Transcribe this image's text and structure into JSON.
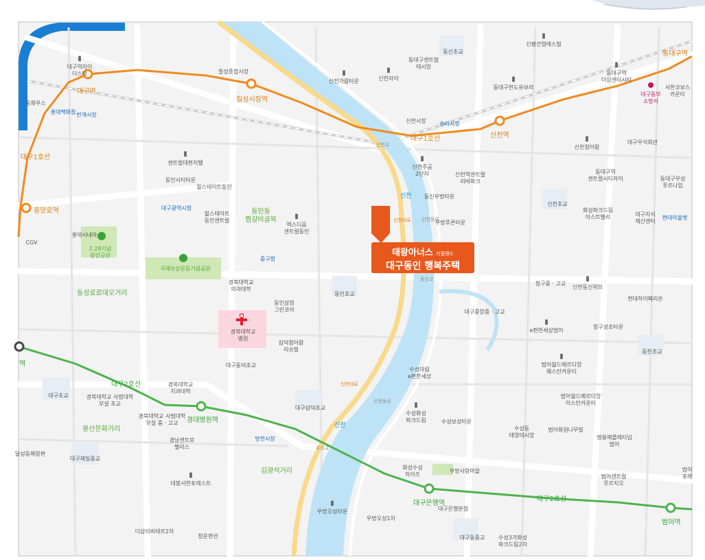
{
  "callout": {
    "brand": "태왕아너스",
    "brand_sub": "리플랜드",
    "title": "대구동인 행복주택",
    "color": "#e8581c"
  },
  "colors": {
    "line1": "#f08a1e",
    "line2": "#4cb34c",
    "river": "#bfe3f6",
    "road": "#e2e2e2",
    "park": "#cfe8b6",
    "hospital": "#fbd6e0"
  },
  "subway_stations": [
    {
      "name": "대구역"
    },
    {
      "name": "칠성시장역"
    },
    {
      "name": "신천역"
    },
    {
      "name": "동대구역"
    },
    {
      "name": "중앙로역"
    },
    {
      "name": "경대병원역"
    },
    {
      "name": "대구은행역"
    },
    {
      "name": "범어역"
    },
    {
      "name": "역"
    }
  ],
  "line_labels": {
    "line1_a": "대구1호선",
    "line1_b": "대구1호선",
    "line2_a": "대구2호선",
    "line2_b": "대구2호선"
  },
  "districts": [
    {
      "name": "동인동\n찜갈비골목"
    },
    {
      "name": "동성로로데오거리"
    },
    {
      "name": "봉산문화거리"
    },
    {
      "name": "김광석거리"
    }
  ],
  "river_labels": [
    "신천",
    "신천"
  ],
  "road_labels": [
    "신천대로",
    "신천대로",
    "신천동로",
    "신천동로",
    "신천교",
    "동신교",
    "수성교"
  ],
  "public": [
    {
      "name": "중구청"
    },
    {
      "name": "대구광역시청"
    },
    {
      "name": "롯데백화점"
    },
    {
      "name": "번개시장"
    },
    {
      "name": "송라시장"
    },
    {
      "name": "현대아울렛"
    },
    {
      "name": "방천시장"
    },
    {
      "name": "대구동부\n소방서"
    }
  ],
  "places": [
    {
      "name": "대구역자이\n더스타"
    },
    {
      "name": "칠성종합시장"
    },
    {
      "name": "신천가람타운"
    },
    {
      "name": "신천자이"
    },
    {
      "name": "동대구센트럴\n데시앙"
    },
    {
      "name": "동신초교"
    },
    {
      "name": "신평건영레스빌"
    },
    {
      "name": "동대구헌도유보라"
    },
    {
      "name": "동대구역\n더샵센터시티"
    },
    {
      "name": "서한코보스\n카운티"
    },
    {
      "name": "신천시장"
    },
    {
      "name": "동화우스"
    },
    {
      "name": "신천청아람"
    },
    {
      "name": "대구우석회관"
    },
    {
      "name": "센트럴데편지텔"
    },
    {
      "name": "동인시티타운"
    },
    {
      "name": "힐스테이트동인"
    },
    {
      "name": "힐스테이트\n동인센트럴"
    },
    {
      "name": "엑스디움\n센트럴동인"
    },
    {
      "name": "신천주공\n2단지"
    },
    {
      "name": "신천역센트럴\n리버파크"
    },
    {
      "name": "동신우방타운"
    },
    {
      "name": "우방푸른타운"
    },
    {
      "name": "동대구역\n센트럴시티자이"
    },
    {
      "name": "동대구우성\n푸르나임"
    },
    {
      "name": "신천초교"
    },
    {
      "name": "화성파크드림\n이스트밸리"
    },
    {
      "name": "대구지식\n재산센터"
    },
    {
      "name": "롯데시네마"
    },
    {
      "name": "CGV"
    },
    {
      "name": "2.28기념\n중앙공원"
    },
    {
      "name": "국채보상운동기념공원"
    },
    {
      "name": "경북대학교\n의과대학"
    },
    {
      "name": "동인삼정\n그린코아"
    },
    {
      "name": "동인초교"
    },
    {
      "name": "청구중 · 고교"
    },
    {
      "name": "신천동신위브"
    },
    {
      "name": "현대하이페리온"
    },
    {
      "name": "대구중앙중 · 고교"
    },
    {
      "name": "e편한세상범어"
    },
    {
      "name": "청구성조타운"
    },
    {
      "name": "동천초교"
    },
    {
      "name": "경북대학교\n병원"
    },
    {
      "name": "삼덕청아람\n리슈빌"
    },
    {
      "name": "대구동덕초교"
    },
    {
      "name": "수성대림\ne편한세상"
    },
    {
      "name": "범어월드메르디앙\n웨스턴카운티"
    },
    {
      "name": "대구초교"
    },
    {
      "name": "경북대학교 사범대학\n부설 초교"
    },
    {
      "name": "경북대학교\n치과대학"
    },
    {
      "name": "대구삼덕초교"
    },
    {
      "name": "경북대학교 사범대학\n부설 중 · 고교"
    },
    {
      "name": "범어월드메르디앙\n이스턴카운티"
    },
    {
      "name": "수성화성\n파크드림"
    },
    {
      "name": "수성보성타운"
    },
    {
      "name": "경남센트로\n팰리스"
    },
    {
      "name": "대구제일중교"
    },
    {
      "name": "달성동해랑편"
    },
    {
      "name": "수성동\n태영데시앙"
    },
    {
      "name": "범어화원나무빌"
    },
    {
      "name": "쌍용예플래티넘\n범어"
    },
    {
      "name": "화성수성\n하이츠"
    },
    {
      "name": "우방사랑마을"
    },
    {
      "name": "범어센트럴\n푸르지오"
    },
    {
      "name": "대봉서한포레스트"
    },
    {
      "name": "우방오성타운"
    },
    {
      "name": "우방오성1차"
    },
    {
      "name": "대구은행본점"
    },
    {
      "name": "더샵리비테르2차"
    },
    {
      "name": "청운맨션"
    },
    {
      "name": "대구동중교"
    },
    {
      "name": "수성3가화성\n파크드림2차"
    },
    {
      "name": "범어\n포레"
    }
  ]
}
